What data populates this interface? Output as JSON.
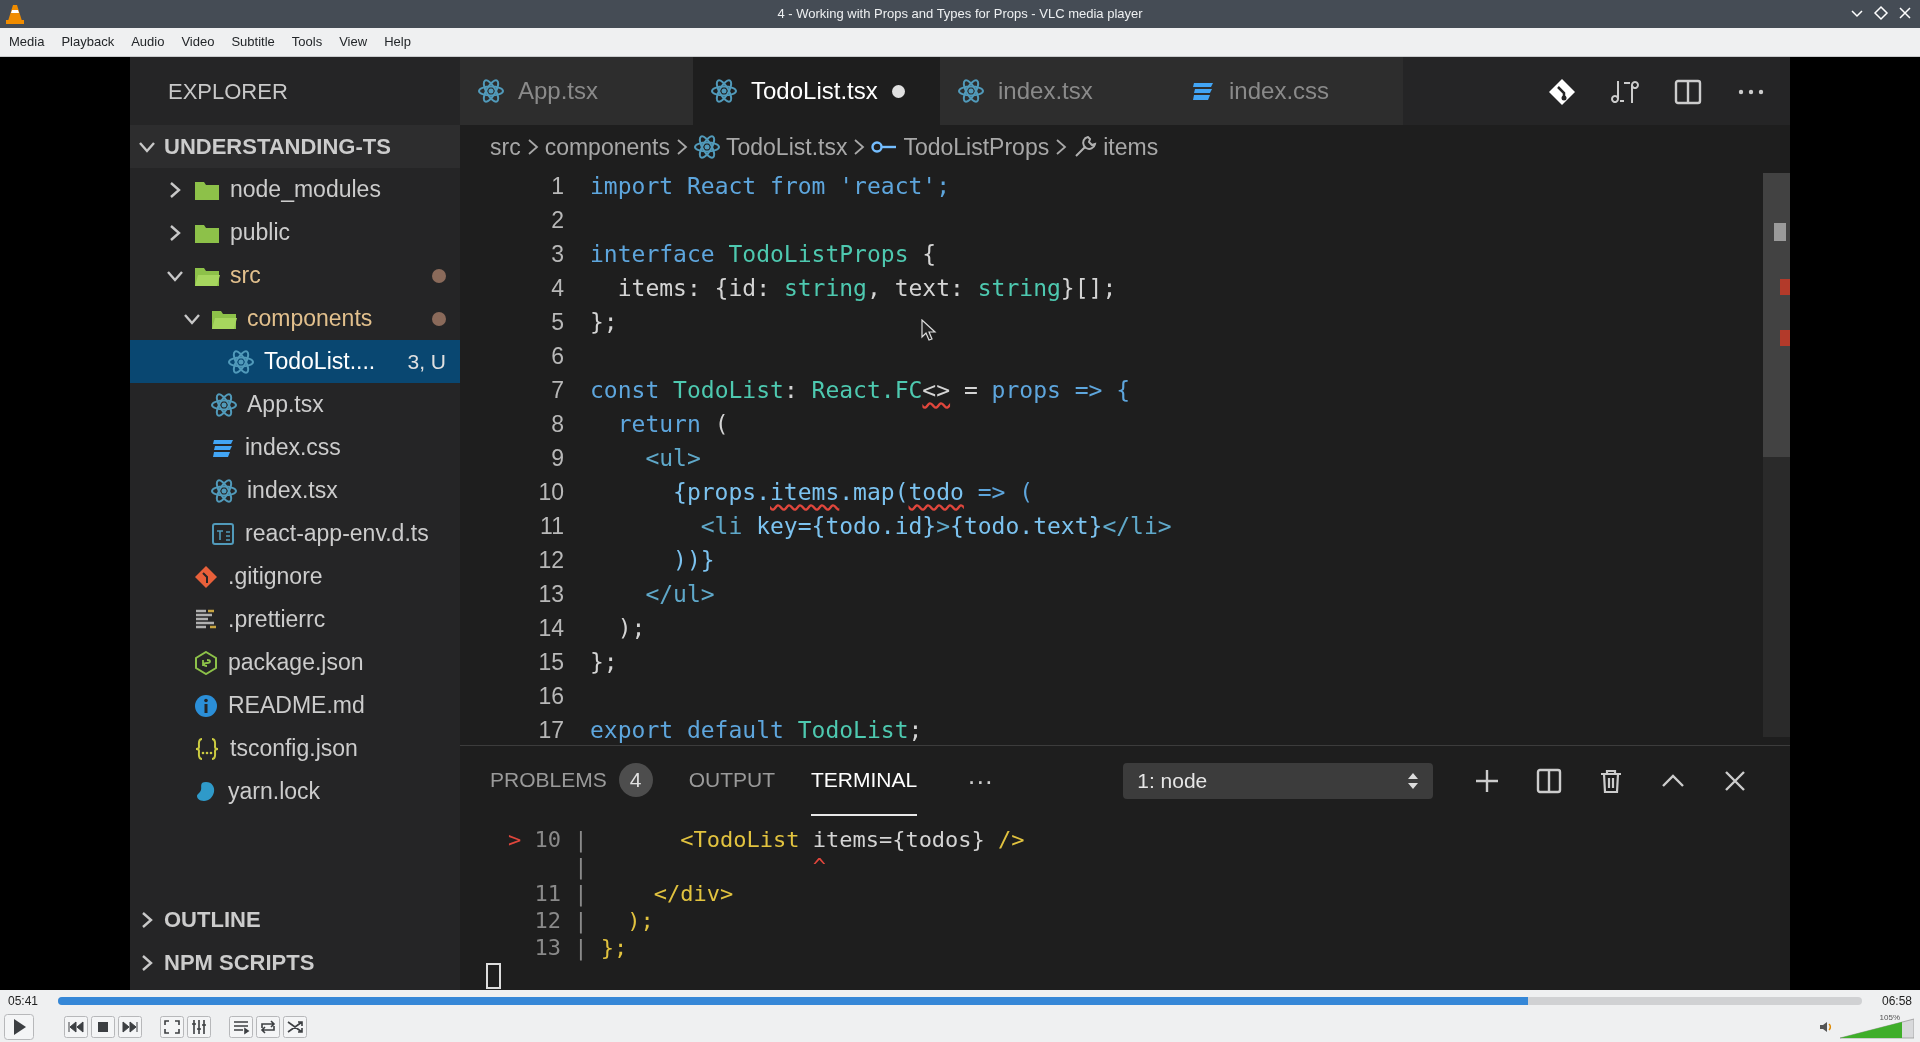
{
  "window": {
    "title": "4 - Working with Props and Types for Props - VLC media player"
  },
  "menu": [
    "Media",
    "Playback",
    "Audio",
    "Video",
    "Subtitle",
    "Tools",
    "View",
    "Help"
  ],
  "video": {
    "explorer": {
      "title": "EXPLORER",
      "sections": [
        {
          "label": "UNDERSTANDING-TS",
          "expanded": true,
          "items": [
            {
              "label": "node_modules",
              "kind": "folder",
              "expanded": false,
              "selected": false,
              "modified": false
            },
            {
              "label": "public",
              "kind": "folder",
              "expanded": false,
              "selected": false,
              "modified": false
            },
            {
              "label": "src",
              "kind": "folder",
              "expanded": true,
              "selected": false,
              "modified": true,
              "children": [
                {
                  "label": "components",
                  "kind": "folder",
                  "expanded": true,
                  "selected": false,
                  "modified": true,
                  "children": [
                    {
                      "label": "TodoList....",
                      "kind": "react",
                      "selected": true,
                      "modified": false,
                      "status": "3, U"
                    }
                  ]
                },
                {
                  "label": "App.tsx",
                  "kind": "react",
                  "selected": false,
                  "modified": false
                },
                {
                  "label": "index.css",
                  "kind": "css",
                  "selected": false,
                  "modified": false
                },
                {
                  "label": "index.tsx",
                  "kind": "react",
                  "selected": false,
                  "modified": false
                },
                {
                  "label": "react-app-env.d.ts",
                  "kind": "ts",
                  "selected": false,
                  "modified": false
                }
              ]
            },
            {
              "label": ".gitignore",
              "kind": "git",
              "selected": false,
              "modified": false
            },
            {
              "label": ".prettierrc",
              "kind": "prettier",
              "selected": false,
              "modified": false
            },
            {
              "label": "package.json",
              "kind": "node",
              "selected": false,
              "modified": false
            },
            {
              "label": "README.md",
              "kind": "info",
              "selected": false,
              "modified": false
            },
            {
              "label": "tsconfig.json",
              "kind": "json",
              "selected": false,
              "modified": false
            },
            {
              "label": "yarn.lock",
              "kind": "yarn",
              "selected": false,
              "modified": false
            }
          ]
        },
        {
          "label": "OUTLINE",
          "expanded": false
        },
        {
          "label": "NPM SCRIPTS",
          "expanded": false
        }
      ]
    },
    "tabs": [
      {
        "label": "App.tsx",
        "kind": "react",
        "selected": false,
        "dirty": false
      },
      {
        "label": "TodoList.tsx",
        "kind": "react",
        "selected": true,
        "dirty": true
      },
      {
        "label": "index.tsx",
        "kind": "react",
        "selected": false,
        "dirty": false
      },
      {
        "label": "index.css",
        "kind": "css",
        "selected": false,
        "dirty": false
      }
    ],
    "breadcrumbs": [
      {
        "label": "src",
        "kind": "text"
      },
      {
        "label": "components",
        "kind": "text"
      },
      {
        "label": "TodoList.tsx",
        "kind": "react"
      },
      {
        "label": "TodoListProps",
        "kind": "interface"
      },
      {
        "label": "items",
        "kind": "property"
      }
    ],
    "code_lines": [
      {
        "number": "1",
        "tokens": [
          {
            "text": "import",
            "kind": "keyword",
            "squiggle": false
          },
          {
            "text": " React ",
            "kind": "keyword",
            "squiggle": false
          },
          {
            "text": "from",
            "kind": "keyword",
            "squiggle": false
          },
          {
            "text": " 'react';",
            "kind": "keyword",
            "squiggle": false
          }
        ]
      },
      {
        "number": "2"
      },
      {
        "number": "3",
        "tokens": [
          {
            "text": "interface",
            "kind": "keyword",
            "squiggle": false
          },
          {
            "text": " TodoListProps",
            "kind": "type",
            "squiggle": false
          },
          {
            "text": " {",
            "kind": "plain",
            "squiggle": false
          }
        ]
      },
      {
        "number": "4",
        "tokens": [
          {
            "text": "  items: {id: ",
            "kind": "plain",
            "squiggle": false
          },
          {
            "text": "string",
            "kind": "type",
            "squiggle": false
          },
          {
            "text": ", text: ",
            "kind": "plain",
            "squiggle": false
          },
          {
            "text": "string",
            "kind": "type",
            "squiggle": false
          },
          {
            "text": "}[];",
            "kind": "plain",
            "squiggle": false
          }
        ]
      },
      {
        "number": "5",
        "tokens": [
          {
            "text": "};",
            "kind": "plain",
            "squiggle": false
          }
        ]
      },
      {
        "number": "6"
      },
      {
        "number": "7",
        "tokens": [
          {
            "text": "const",
            "kind": "keyword",
            "squiggle": false
          },
          {
            "text": " TodoList",
            "kind": "type",
            "squiggle": false
          },
          {
            "text": ": ",
            "kind": "plain",
            "squiggle": false
          },
          {
            "text": "React.FC",
            "kind": "type",
            "squiggle": false
          },
          {
            "text": "<>",
            "kind": "plain",
            "squiggle": true
          },
          {
            "text": " = ",
            "kind": "plain",
            "squiggle": false
          },
          {
            "text": "props",
            "kind": "keyword",
            "squiggle": false
          },
          {
            "text": " => {",
            "kind": "keyword",
            "squiggle": false
          }
        ]
      },
      {
        "number": "8",
        "tokens": [
          {
            "text": "  return",
            "kind": "keyword",
            "squiggle": false
          },
          {
            "text": " (",
            "kind": "plain",
            "squiggle": false
          }
        ]
      },
      {
        "number": "9",
        "tokens": [
          {
            "text": "    <ul>",
            "kind": "tag",
            "squiggle": false
          }
        ]
      },
      {
        "number": "10",
        "tokens": [
          {
            "text": "      {props.",
            "kind": "ident",
            "squiggle": false
          },
          {
            "text": "items",
            "kind": "ident",
            "squiggle": true
          },
          {
            "text": ".map(",
            "kind": "ident",
            "squiggle": false
          },
          {
            "text": "todo",
            "kind": "ident",
            "squiggle": true
          },
          {
            "text": " => (",
            "kind": "keyword",
            "squiggle": false
          }
        ]
      },
      {
        "number": "11",
        "tokens": [
          {
            "text": "        <li ",
            "kind": "tag",
            "squiggle": false
          },
          {
            "text": "key={todo.id}",
            "kind": "ident",
            "squiggle": false
          },
          {
            "text": ">",
            "kind": "tag",
            "squiggle": false
          },
          {
            "text": "{todo.text}",
            "kind": "ident",
            "squiggle": false
          },
          {
            "text": "</li>",
            "kind": "tag",
            "squiggle": false
          }
        ]
      },
      {
        "number": "12",
        "tokens": [
          {
            "text": "      ))}",
            "kind": "ident",
            "squiggle": false
          }
        ]
      },
      {
        "number": "13",
        "tokens": [
          {
            "text": "    </ul>",
            "kind": "tag",
            "squiggle": false
          }
        ]
      },
      {
        "number": "14",
        "tokens": [
          {
            "text": "  );",
            "kind": "plain",
            "squiggle": false
          }
        ]
      },
      {
        "number": "15",
        "tokens": [
          {
            "text": "};",
            "kind": "plain",
            "squiggle": false
          }
        ]
      },
      {
        "number": "16"
      },
      {
        "number": "17",
        "tokens": [
          {
            "text": "export default ",
            "kind": "keyword",
            "squiggle": false
          },
          {
            "text": "TodoList",
            "kind": "type",
            "squiggle": false
          },
          {
            "text": ";",
            "kind": "plain",
            "squiggle": false
          }
        ]
      }
    ],
    "panel": {
      "tabs": [
        {
          "label": "PROBLEMS",
          "badge": "4",
          "selected": false
        },
        {
          "label": "OUTPUT",
          "selected": false
        },
        {
          "label": "TERMINAL",
          "selected": true
        }
      ],
      "more": "···",
      "terminal_select": "1: node",
      "terminal_lines": [
        {
          "tokens": [
            {
              "text": "> ",
              "kind": "error"
            },
            {
              "text": "10 | ",
              "kind": "gutter"
            },
            {
              "text": "      <TodoList",
              "kind": "jsx"
            },
            {
              "text": " items={todos} ",
              "kind": "plain"
            },
            {
              "text": "/>",
              "kind": "jsx"
            }
          ]
        },
        {
          "tokens": [
            {
              "text": "     |",
              "kind": "gutter"
            },
            {
              "text": "                 ^",
              "kind": "error"
            }
          ]
        },
        {
          "tokens": [
            {
              "text": "  11 | ",
              "kind": "gutter"
            },
            {
              "text": "    </div>",
              "kind": "jsx"
            }
          ]
        },
        {
          "tokens": [
            {
              "text": "  12 | ",
              "kind": "gutter"
            },
            {
              "text": "  );",
              "kind": "jsx"
            }
          ]
        },
        {
          "tokens": [
            {
              "text": "  13 | ",
              "kind": "gutter"
            },
            {
              "text": "};",
              "kind": "jsx"
            }
          ]
        }
      ]
    }
  },
  "player": {
    "elapsed": "05:41",
    "total": "06:58",
    "progress": {
      "level": 0.815
    },
    "volume": {
      "level": 0.84,
      "reading": "105%"
    }
  }
}
